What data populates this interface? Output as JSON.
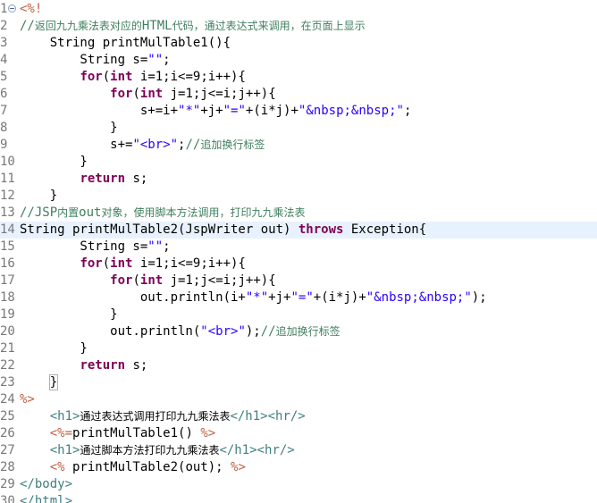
{
  "editor": {
    "lines": [
      {
        "num": "1",
        "fold": true,
        "tokens": [
          {
            "t": "<%!",
            "c": "jsp"
          }
        ]
      },
      {
        "num": "2",
        "tokens": [
          {
            "t": "//",
            "c": "com"
          },
          {
            "t": "返回九九乘法表对应的",
            "c": "com cjk"
          },
          {
            "t": "HTML",
            "c": "com"
          },
          {
            "t": "代码，通过表达式来调用，在页面上显示",
            "c": "com cjk"
          }
        ]
      },
      {
        "num": "3",
        "tokens": [
          {
            "t": "    String printMulTable1(){",
            "c": "pl"
          }
        ]
      },
      {
        "num": "4",
        "tokens": [
          {
            "t": "        String s=",
            "c": "pl"
          },
          {
            "t": "\"\"",
            "c": "str"
          },
          {
            "t": ";",
            "c": "pl"
          }
        ]
      },
      {
        "num": "5",
        "tokens": [
          {
            "t": "        ",
            "c": "pl"
          },
          {
            "t": "for",
            "c": "kw"
          },
          {
            "t": "(",
            "c": "pl"
          },
          {
            "t": "int",
            "c": "kw"
          },
          {
            "t": " i=1;i<=9;i++){",
            "c": "pl"
          }
        ]
      },
      {
        "num": "6",
        "tokens": [
          {
            "t": "            ",
            "c": "pl"
          },
          {
            "t": "for",
            "c": "kw"
          },
          {
            "t": "(",
            "c": "pl"
          },
          {
            "t": "int",
            "c": "kw"
          },
          {
            "t": " j=1;j<=i;j++){",
            "c": "pl"
          }
        ]
      },
      {
        "num": "7",
        "tokens": [
          {
            "t": "                s+=i+",
            "c": "pl"
          },
          {
            "t": "\"*\"",
            "c": "str"
          },
          {
            "t": "+j+",
            "c": "pl"
          },
          {
            "t": "\"=\"",
            "c": "str"
          },
          {
            "t": "+(i*j)+",
            "c": "pl"
          },
          {
            "t": "\"&nbsp;&nbsp;\"",
            "c": "str"
          },
          {
            "t": ";",
            "c": "pl"
          }
        ]
      },
      {
        "num": "8",
        "tokens": [
          {
            "t": "            }",
            "c": "pl"
          }
        ]
      },
      {
        "num": "9",
        "tokens": [
          {
            "t": "            s+=",
            "c": "pl"
          },
          {
            "t": "\"<br>\"",
            "c": "str"
          },
          {
            "t": ";",
            "c": "pl"
          },
          {
            "t": "//",
            "c": "com"
          },
          {
            "t": "追加换行标签",
            "c": "com cjk"
          }
        ]
      },
      {
        "num": "10",
        "tokens": [
          {
            "t": "        }",
            "c": "pl"
          }
        ]
      },
      {
        "num": "11",
        "tokens": [
          {
            "t": "        ",
            "c": "pl"
          },
          {
            "t": "return",
            "c": "kw"
          },
          {
            "t": " s;",
            "c": "pl"
          }
        ]
      },
      {
        "num": "12",
        "tokens": [
          {
            "t": "    }",
            "c": "pl"
          }
        ]
      },
      {
        "num": "13",
        "tokens": [
          {
            "t": "//JSP",
            "c": "com"
          },
          {
            "t": "内置",
            "c": "com cjk"
          },
          {
            "t": "out",
            "c": "com"
          },
          {
            "t": "对象，使用脚本方法调用，打印九九乘法表",
            "c": "com cjk"
          }
        ]
      },
      {
        "num": "14",
        "highlight": true,
        "tokens": [
          {
            "t": "String printMulTable2(JspWriter out) ",
            "c": "pl"
          },
          {
            "t": "throws",
            "c": "kw"
          },
          {
            "t": " Exception{",
            "c": "pl"
          }
        ]
      },
      {
        "num": "15",
        "tokens": [
          {
            "t": "        String s=",
            "c": "pl"
          },
          {
            "t": "\"\"",
            "c": "str"
          },
          {
            "t": ";",
            "c": "pl"
          }
        ]
      },
      {
        "num": "16",
        "tokens": [
          {
            "t": "        ",
            "c": "pl"
          },
          {
            "t": "for",
            "c": "kw"
          },
          {
            "t": "(",
            "c": "pl"
          },
          {
            "t": "int",
            "c": "kw"
          },
          {
            "t": " i=1;i<=9;i++){",
            "c": "pl"
          }
        ]
      },
      {
        "num": "17",
        "tokens": [
          {
            "t": "            ",
            "c": "pl"
          },
          {
            "t": "for",
            "c": "kw"
          },
          {
            "t": "(",
            "c": "pl"
          },
          {
            "t": "int",
            "c": "kw"
          },
          {
            "t": " j=1;j<=i;j++){",
            "c": "pl"
          }
        ]
      },
      {
        "num": "18",
        "tokens": [
          {
            "t": "                out.println(i+",
            "c": "pl"
          },
          {
            "t": "\"*\"",
            "c": "str"
          },
          {
            "t": "+j+",
            "c": "pl"
          },
          {
            "t": "\"=\"",
            "c": "str"
          },
          {
            "t": "+(i*j)+",
            "c": "pl"
          },
          {
            "t": "\"&nbsp;&nbsp;\"",
            "c": "str"
          },
          {
            "t": ");",
            "c": "pl"
          }
        ]
      },
      {
        "num": "19",
        "tokens": [
          {
            "t": "            }",
            "c": "pl"
          }
        ]
      },
      {
        "num": "20",
        "tokens": [
          {
            "t": "            out.println(",
            "c": "pl"
          },
          {
            "t": "\"<br>\"",
            "c": "str"
          },
          {
            "t": ");",
            "c": "pl"
          },
          {
            "t": "//",
            "c": "com"
          },
          {
            "t": "追加换行标签",
            "c": "com cjk"
          }
        ]
      },
      {
        "num": "21",
        "tokens": [
          {
            "t": "        }",
            "c": "pl"
          }
        ]
      },
      {
        "num": "22",
        "tokens": [
          {
            "t": "        ",
            "c": "pl"
          },
          {
            "t": "return",
            "c": "kw"
          },
          {
            "t": " s;",
            "c": "pl"
          }
        ]
      },
      {
        "num": "23",
        "tokens": [
          {
            "t": "    ",
            "c": "pl"
          },
          {
            "t": "}",
            "c": "pl bracket"
          }
        ]
      },
      {
        "num": "24",
        "tokens": [
          {
            "t": "%>",
            "c": "jsp"
          }
        ]
      },
      {
        "num": "25",
        "tokens": [
          {
            "t": "    ",
            "c": "pl"
          },
          {
            "t": "<h1>",
            "c": "tag"
          },
          {
            "t": "通过表达式调用打印九九乘法表",
            "c": "pl cjk"
          },
          {
            "t": "</h1><hr/>",
            "c": "tag"
          }
        ]
      },
      {
        "num": "26",
        "tokens": [
          {
            "t": "    ",
            "c": "pl"
          },
          {
            "t": "<%=",
            "c": "jsp"
          },
          {
            "t": "printMulTable1() ",
            "c": "pl"
          },
          {
            "t": "%>",
            "c": "jsp"
          }
        ]
      },
      {
        "num": "27",
        "tokens": [
          {
            "t": "    ",
            "c": "pl"
          },
          {
            "t": "<h1>",
            "c": "tag"
          },
          {
            "t": "通过脚本方法打印九九乘法表",
            "c": "pl cjk"
          },
          {
            "t": "</h1><hr/>",
            "c": "tag"
          }
        ]
      },
      {
        "num": "28",
        "tokens": [
          {
            "t": "    ",
            "c": "pl"
          },
          {
            "t": "<%",
            "c": "jsp"
          },
          {
            "t": " printMulTable2(out); ",
            "c": "pl"
          },
          {
            "t": "%>",
            "c": "jsp"
          }
        ]
      },
      {
        "num": "29",
        "tokens": [
          {
            "t": "</body>",
            "c": "tag"
          }
        ]
      },
      {
        "num": "30",
        "tokens": [
          {
            "t": "</html>",
            "c": "tag"
          }
        ]
      }
    ]
  },
  "colors": {
    "background": "#ffffff",
    "current_line": "#e8f2fe",
    "jsp_delimiter": "#bf5f3f",
    "keyword": "#7f0055",
    "string": "#2a00ff",
    "comment": "#3f7f5f",
    "html_tag": "#3f7f7f",
    "line_number": "#787878"
  }
}
